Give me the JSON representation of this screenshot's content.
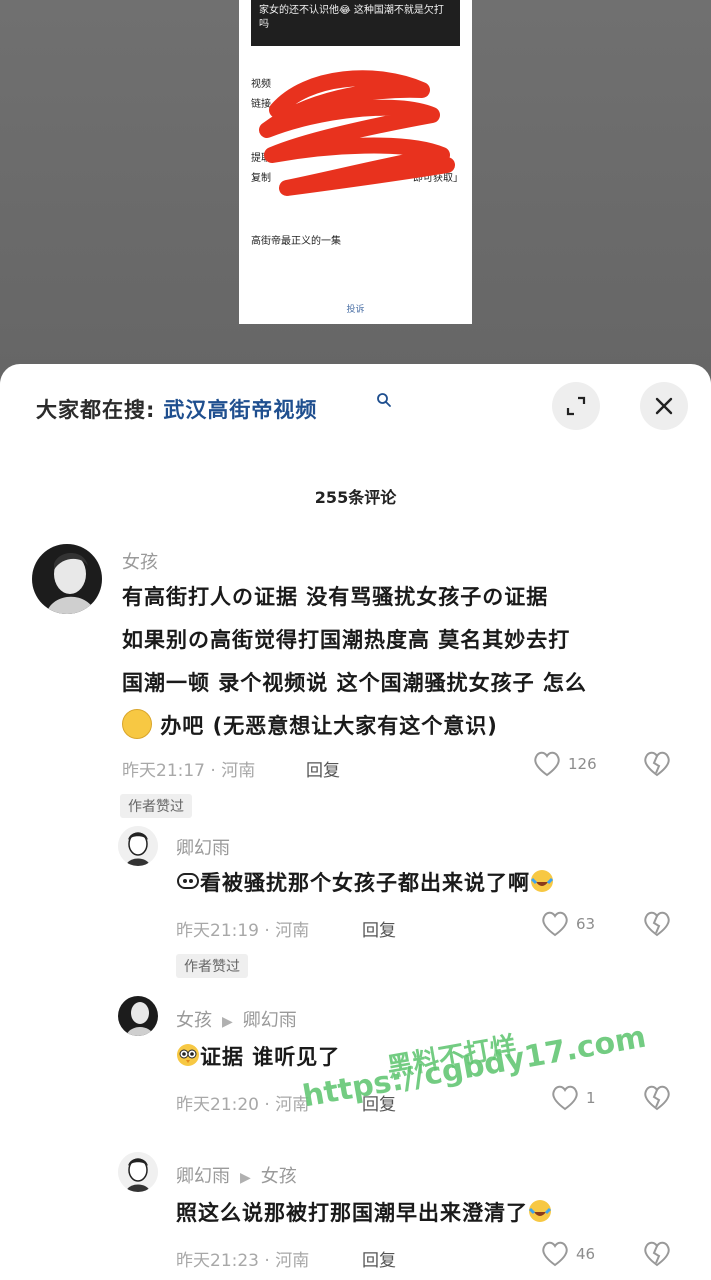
{
  "background_card": {
    "top_text": "家女的还不认识他😂 这种国潮不就是欠打吗",
    "label_video": "视频",
    "label_link": "链接",
    "label_extract": "提取",
    "label_copy": "复制",
    "copy_tail": "即可获取」",
    "title": "高街帝最正义的一集",
    "report": "投诉"
  },
  "sheet": {
    "search_prefix": "大家都在搜:",
    "search_term": "武汉高街帝视频",
    "comment_count": "255条评论"
  },
  "comments": [
    {
      "author": "女孩",
      "lines": [
        "有高街打人の证据 没有骂骚扰女孩子の证据",
        "如果别の高街觉得打国潮热度高 莫名其妙去打",
        "国潮一顿 录个视频说 这个国潮骚扰女孩子 怎么",
        "办吧 (无恶意想让大家有这个意识)"
      ],
      "time": "昨天21:17 · 河南",
      "reply": "回复",
      "likes": "126",
      "author_liked": "作者赞过"
    },
    {
      "author": "卿幻雨",
      "text": "看被骚扰那个女孩子都出来说了啊",
      "time": "昨天21:19 · 河南",
      "reply": "回复",
      "likes": "63",
      "author_liked": "作者赞过"
    },
    {
      "author": "女孩",
      "reply_to": "卿幻雨",
      "text": "证据 谁听见了",
      "time": "昨天21:20 · 河南",
      "reply": "回复",
      "likes": "1"
    },
    {
      "author": "卿幻雨",
      "reply_to": "女孩",
      "text": "照这么说那被打那国潮早出来澄清了",
      "time": "昨天21:23 · 河南",
      "reply": "回复",
      "likes": "46"
    }
  ],
  "watermark": {
    "line1": "黑料不打烊",
    "line2": "https://cgbdy17.com"
  },
  "colors": {
    "search_term": "#1f4f8f",
    "scribble": "#e8321e",
    "watermark": "#4cbe5f"
  }
}
